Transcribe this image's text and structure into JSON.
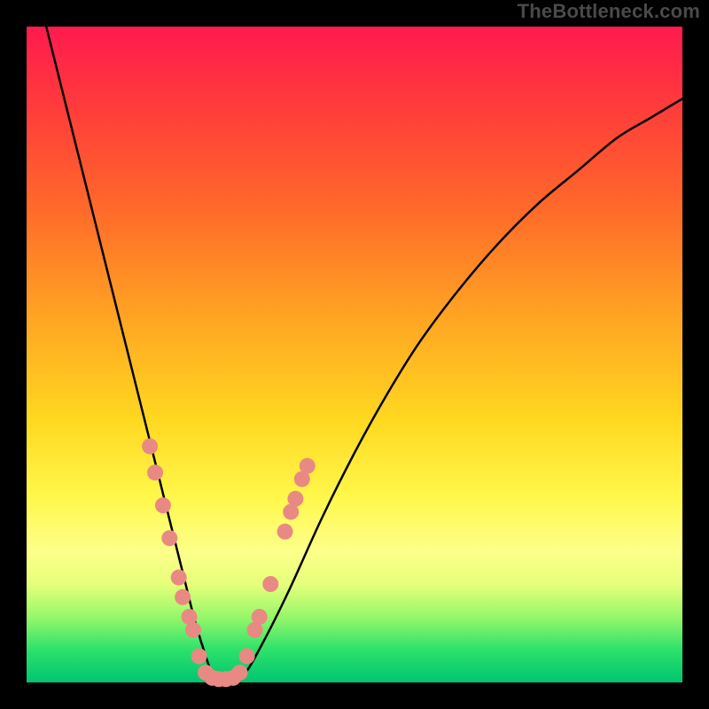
{
  "watermark": "TheBottleneck.com",
  "chart_data": {
    "type": "line",
    "title": "",
    "xlabel": "",
    "ylabel": "",
    "xlim": [
      0,
      100
    ],
    "ylim": [
      0,
      100
    ],
    "x": [
      3,
      6,
      9,
      12,
      15,
      18,
      19.5,
      21,
      22.5,
      24,
      25.5,
      27,
      28.5,
      30.5,
      33,
      36,
      40,
      45,
      50,
      55,
      60,
      66,
      72,
      78,
      84,
      90,
      95,
      100
    ],
    "values": [
      100,
      88,
      76,
      64,
      52,
      40,
      34,
      28,
      22,
      16,
      10,
      5,
      1,
      0,
      1,
      6,
      14,
      25,
      35,
      44,
      52,
      60,
      67,
      73,
      78,
      83,
      86,
      89
    ],
    "series": [
      {
        "name": "bottleneck-curve",
        "x": [
          3,
          6,
          9,
          12,
          15,
          18,
          19.5,
          21,
          22.5,
          24,
          25.5,
          27,
          28.5,
          30.5,
          33,
          36,
          40,
          45,
          50,
          55,
          60,
          66,
          72,
          78,
          84,
          90,
          95,
          100
        ],
        "values": [
          100,
          88,
          76,
          64,
          52,
          40,
          34,
          28,
          22,
          16,
          10,
          5,
          1,
          0,
          1,
          6,
          14,
          25,
          35,
          44,
          52,
          60,
          67,
          73,
          78,
          83,
          86,
          89
        ]
      }
    ],
    "markers": [
      {
        "x": 18.8,
        "y": 36
      },
      {
        "x": 19.6,
        "y": 32
      },
      {
        "x": 20.8,
        "y": 27
      },
      {
        "x": 21.8,
        "y": 22
      },
      {
        "x": 23.2,
        "y": 16
      },
      {
        "x": 23.8,
        "y": 13
      },
      {
        "x": 24.8,
        "y": 10
      },
      {
        "x": 25.4,
        "y": 8
      },
      {
        "x": 26.3,
        "y": 4
      },
      {
        "x": 27.3,
        "y": 1.5
      },
      {
        "x": 28.3,
        "y": 0.7
      },
      {
        "x": 29.3,
        "y": 0.5
      },
      {
        "x": 30.4,
        "y": 0.5
      },
      {
        "x": 31.5,
        "y": 0.7
      },
      {
        "x": 32.5,
        "y": 1.5
      },
      {
        "x": 33.6,
        "y": 4
      },
      {
        "x": 34.8,
        "y": 8
      },
      {
        "x": 35.5,
        "y": 10
      },
      {
        "x": 37.2,
        "y": 15
      },
      {
        "x": 39.4,
        "y": 23
      },
      {
        "x": 40.3,
        "y": 26
      },
      {
        "x": 41.0,
        "y": 28
      },
      {
        "x": 42.0,
        "y": 31
      },
      {
        "x": 42.8,
        "y": 33
      }
    ],
    "marker_color": "#e88a83",
    "curve_color": "#000000"
  }
}
